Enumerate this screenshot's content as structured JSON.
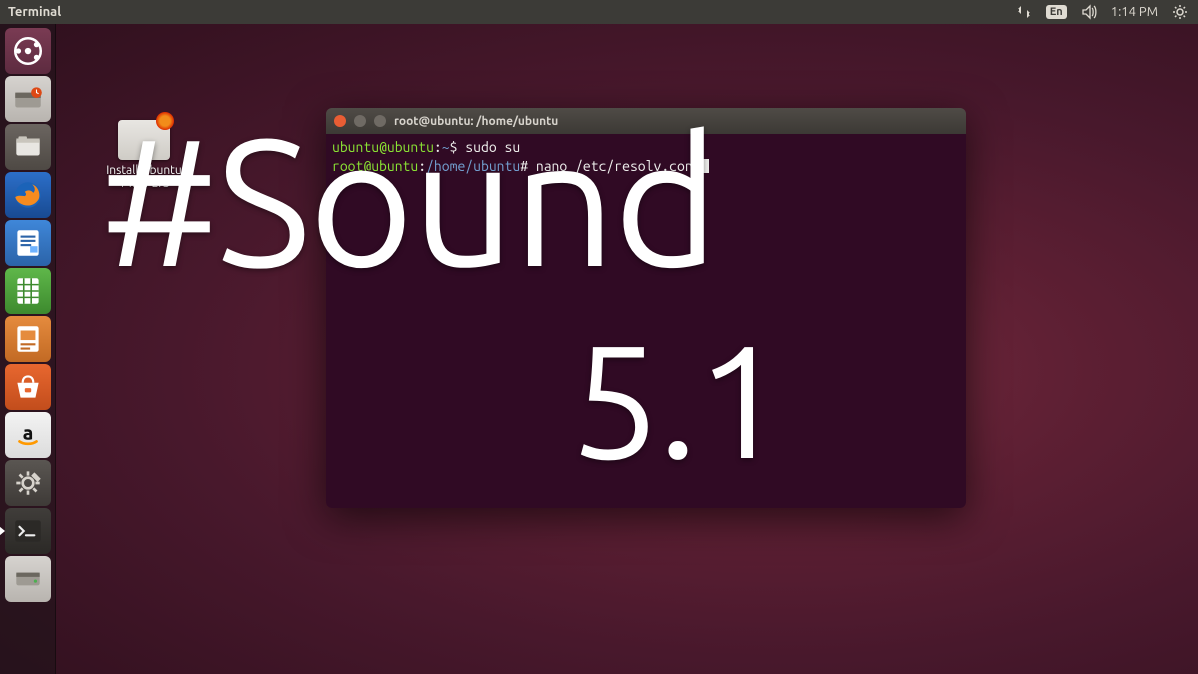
{
  "menubar": {
    "app_title": "Terminal",
    "language": "En",
    "time": "1:14 PM"
  },
  "launcher": {
    "items": [
      {
        "name": "dash-home"
      },
      {
        "name": "install-ubuntu"
      },
      {
        "name": "files"
      },
      {
        "name": "firefox"
      },
      {
        "name": "libreoffice-writer"
      },
      {
        "name": "libreoffice-calc"
      },
      {
        "name": "libreoffice-impress"
      },
      {
        "name": "ubuntu-software"
      },
      {
        "name": "amazon"
      },
      {
        "name": "system-settings"
      },
      {
        "name": "terminal"
      },
      {
        "name": "external-drive"
      }
    ]
  },
  "desktop_icon": {
    "label": "Install Ubuntu 14.04 LTS"
  },
  "terminal": {
    "title": "root@ubuntu: /home/ubuntu",
    "lines": {
      "l1_user": "ubuntu@ubuntu",
      "l1_sep": ":",
      "l1_path": "~",
      "l1_prompt": "$ ",
      "l1_cmd": "sudo su",
      "l2_user": "root@ubuntu",
      "l2_sep": ":",
      "l2_path": "/home/ubuntu",
      "l2_prompt": "# ",
      "l2_cmd": "nano /etc/resolv.conf"
    }
  },
  "overlay": {
    "sound": "#Sound",
    "version": "5.1"
  }
}
